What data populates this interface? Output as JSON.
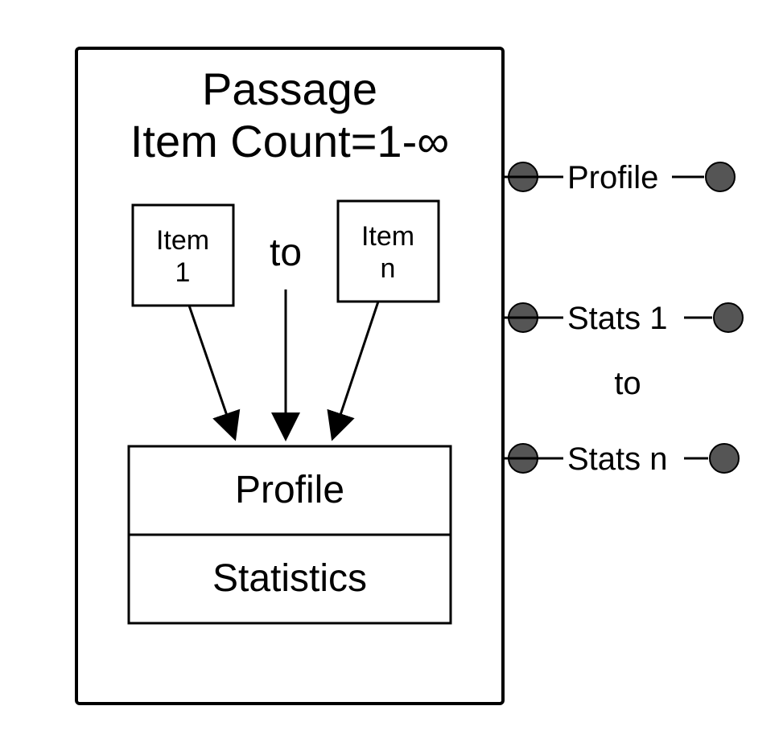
{
  "diagram": {
    "title_line1": "Passage",
    "title_line2": "Item Count=1-∞",
    "item1_line1": "Item",
    "item1_line2": "1",
    "item_to": "to",
    "itemn_line1": "Item",
    "itemn_line2": "n",
    "profile_box": "Profile",
    "stats_box": "Statistics"
  },
  "side": {
    "profile": "Profile",
    "stats1": "Stats 1",
    "to": "to",
    "statsn": "Stats n"
  }
}
